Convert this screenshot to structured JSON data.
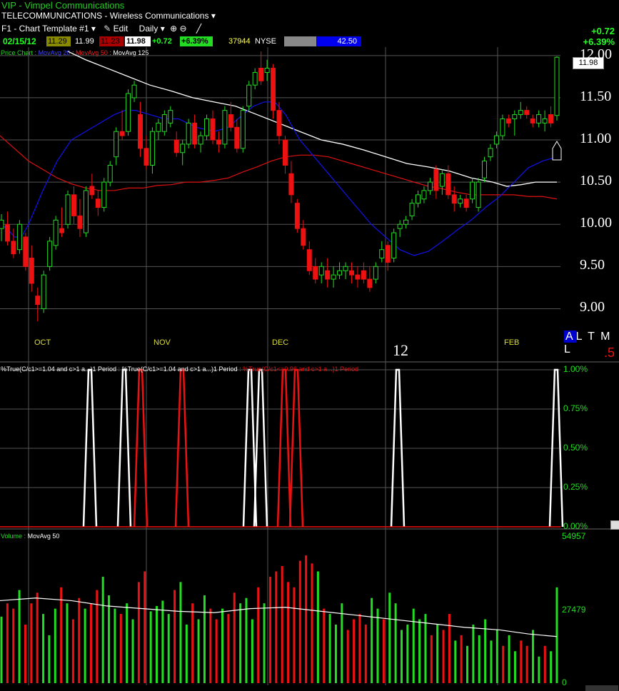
{
  "header": {
    "title": "VIP - Vimpel Communications",
    "sector": "TELECOMMUNICATIONS - Wireless Communications",
    "template": "F1 - Chart Template #1",
    "edit_label": "Edit",
    "period": "Daily"
  },
  "quote": {
    "date": "02/15/12",
    "open": "11.29",
    "high": "11.99",
    "low": "11.23",
    "close": "11.98",
    "change": "+0.72",
    "change_pct": "+6.39%",
    "volume": "37944",
    "exchange": "NYSE",
    "rank": "42.50",
    "rank_fill": 0.42
  },
  "corner": {
    "change": "+0.72",
    "change_pct": "+6.39%"
  },
  "last_price_tag": "11.98",
  "timeframes": {
    "active": "A",
    "others": "L T M L",
    "bottom_label": ".5"
  },
  "colors": {
    "up": "#22dd22",
    "down": "#ee1111",
    "ma20": "#1111ee",
    "ma50": "#dd1111",
    "ma125": "#ffffff",
    "accent": "#0000cc"
  },
  "legends": {
    "price": {
      "p0": "Price Chart",
      "p1": "MovAvg 20",
      "p2": "MovAvg 50",
      "p3": "MovAvg 125"
    },
    "ind": {
      "i1": "%True(C/c1>=1.04 and c>1 a...)1 Period",
      "i2": "%True(C/c1>=1.04 and c>1 a...)1 Period",
      "i3": "%True(C/c1<=0.96 and c>1 a...)1 Period"
    },
    "vol": {
      "v1": "Volume",
      "v2": "MovAvg 50"
    }
  },
  "chart_data": [
    {
      "type": "candlestick",
      "title": "Price Chart",
      "x_ticks": [
        "OCT",
        "NOV",
        "DEC",
        "12",
        "FEB"
      ],
      "y_ticks": [
        "12.00",
        "11.50",
        "11.00",
        "10.50",
        "10.00",
        "9.50",
        "9.00"
      ],
      "ylim": [
        8.75,
        12.1
      ],
      "grid": true,
      "candles": [
        [
          9.95,
          10.12,
          9.8,
          10.05
        ],
        [
          10.0,
          10.15,
          9.75,
          9.8
        ],
        [
          9.8,
          9.95,
          9.6,
          9.65
        ],
        [
          9.7,
          10.05,
          9.65,
          10.0
        ],
        [
          9.85,
          9.9,
          9.45,
          9.5
        ],
        [
          9.6,
          9.75,
          9.2,
          9.3
        ],
        [
          9.15,
          9.25,
          8.85,
          9.05
        ],
        [
          9.0,
          9.45,
          8.95,
          9.4
        ],
        [
          9.5,
          9.85,
          9.45,
          9.8
        ],
        [
          9.75,
          10.1,
          9.7,
          10.05
        ],
        [
          9.95,
          10.2,
          9.85,
          9.9
        ],
        [
          10.0,
          10.4,
          9.95,
          10.35
        ],
        [
          10.35,
          10.45,
          10.0,
          10.1
        ],
        [
          10.1,
          10.3,
          9.85,
          9.95
        ],
        [
          9.9,
          10.45,
          9.85,
          10.4
        ],
        [
          10.45,
          10.6,
          10.3,
          10.35
        ],
        [
          10.3,
          10.4,
          10.1,
          10.2
        ],
        [
          10.2,
          10.55,
          10.15,
          10.5
        ],
        [
          10.5,
          10.75,
          10.45,
          10.7
        ],
        [
          10.8,
          11.15,
          10.7,
          11.1
        ],
        [
          11.1,
          11.35,
          11.0,
          11.05
        ],
        [
          11.1,
          11.6,
          11.05,
          11.55
        ],
        [
          11.5,
          11.7,
          11.45,
          11.65
        ],
        [
          11.3,
          11.45,
          10.8,
          10.9
        ],
        [
          10.9,
          11.05,
          10.65,
          10.7
        ],
        [
          10.7,
          11.15,
          10.6,
          11.1
        ],
        [
          11.1,
          11.25,
          11.0,
          11.2
        ],
        [
          11.1,
          11.35,
          11.05,
          11.3
        ],
        [
          11.2,
          11.4,
          11.15,
          11.35
        ],
        [
          11.0,
          11.1,
          10.8,
          10.85
        ],
        [
          10.85,
          11.0,
          10.7,
          10.95
        ],
        [
          10.95,
          11.25,
          10.9,
          11.2
        ],
        [
          11.2,
          11.3,
          10.9,
          10.95
        ],
        [
          10.95,
          11.1,
          10.85,
          11.05
        ],
        [
          11.05,
          11.3,
          11.0,
          11.25
        ],
        [
          11.25,
          11.35,
          10.95,
          11.0
        ],
        [
          11.0,
          11.1,
          10.85,
          10.95
        ],
        [
          10.95,
          11.4,
          10.9,
          11.35
        ],
        [
          11.3,
          11.45,
          11.1,
          11.15
        ],
        [
          11.15,
          11.25,
          10.85,
          10.9
        ],
        [
          10.9,
          11.4,
          10.85,
          11.35
        ],
        [
          11.4,
          11.7,
          11.35,
          11.65
        ],
        [
          11.65,
          11.85,
          11.6,
          11.8
        ],
        [
          11.85,
          12.05,
          11.65,
          11.7
        ],
        [
          11.8,
          11.95,
          11.7,
          11.85
        ],
        [
          11.85,
          11.9,
          11.25,
          11.35
        ],
        [
          11.35,
          11.45,
          10.95,
          11.05
        ],
        [
          11.0,
          11.05,
          10.6,
          10.7
        ],
        [
          10.6,
          10.75,
          10.25,
          10.35
        ],
        [
          10.25,
          10.3,
          9.9,
          9.95
        ],
        [
          9.95,
          10.05,
          9.7,
          9.75
        ],
        [
          9.7,
          9.8,
          9.4,
          9.45
        ],
        [
          9.5,
          9.6,
          9.3,
          9.35
        ],
        [
          9.4,
          9.55,
          9.3,
          9.5
        ],
        [
          9.45,
          9.6,
          9.25,
          9.35
        ],
        [
          9.35,
          9.5,
          9.25,
          9.4
        ],
        [
          9.4,
          9.55,
          9.35,
          9.45
        ],
        [
          9.45,
          9.55,
          9.35,
          9.5
        ],
        [
          9.45,
          9.55,
          9.3,
          9.4
        ],
        [
          9.4,
          9.5,
          9.25,
          9.35
        ],
        [
          9.45,
          9.55,
          9.3,
          9.35
        ],
        [
          9.35,
          9.5,
          9.2,
          9.25
        ],
        [
          9.35,
          9.55,
          9.3,
          9.5
        ],
        [
          9.6,
          9.8,
          9.55,
          9.7
        ],
        [
          9.75,
          9.8,
          9.45,
          9.55
        ],
        [
          9.6,
          9.95,
          9.55,
          9.9
        ],
        [
          9.95,
          10.05,
          9.85,
          10.0
        ],
        [
          10.0,
          10.1,
          9.95,
          10.05
        ],
        [
          10.1,
          10.3,
          10.05,
          10.25
        ],
        [
          10.25,
          10.4,
          10.2,
          10.35
        ],
        [
          10.3,
          10.45,
          10.25,
          10.4
        ],
        [
          10.4,
          10.55,
          10.35,
          10.5
        ],
        [
          10.65,
          10.7,
          10.3,
          10.4
        ],
        [
          10.45,
          10.65,
          10.35,
          10.6
        ],
        [
          10.6,
          10.7,
          10.3,
          10.35
        ],
        [
          10.35,
          10.45,
          10.15,
          10.25
        ],
        [
          10.25,
          10.35,
          10.2,
          10.3
        ],
        [
          10.3,
          10.35,
          10.15,
          10.2
        ],
        [
          10.3,
          10.55,
          10.25,
          10.5
        ],
        [
          10.2,
          10.55,
          10.15,
          10.5
        ],
        [
          10.55,
          10.8,
          10.5,
          10.75
        ],
        [
          10.8,
          10.95,
          10.75,
          10.9
        ],
        [
          10.95,
          11.1,
          10.9,
          11.05
        ],
        [
          11.05,
          11.3,
          11.0,
          11.25
        ],
        [
          11.25,
          11.3,
          11.15,
          11.2
        ],
        [
          11.25,
          11.35,
          11.05,
          11.3
        ],
        [
          11.3,
          11.45,
          11.25,
          11.35
        ],
        [
          11.35,
          11.4,
          11.25,
          11.3
        ],
        [
          11.25,
          11.3,
          11.15,
          11.2
        ],
        [
          11.2,
          11.35,
          11.15,
          11.3
        ],
        [
          11.2,
          11.35,
          11.1,
          11.25
        ],
        [
          11.3,
          11.4,
          11.15,
          11.2
        ],
        [
          11.29,
          11.99,
          11.23,
          11.98
        ]
      ],
      "ma20_points": [
        [
          0,
          10.0
        ],
        [
          10,
          9.95
        ],
        [
          20,
          9.85
        ],
        [
          30,
          9.85
        ],
        [
          40,
          10.0
        ],
        [
          50,
          10.2
        ],
        [
          60,
          10.4
        ],
        [
          80,
          10.75
        ],
        [
          100,
          11.0
        ],
        [
          120,
          11.1
        ],
        [
          140,
          11.2
        ],
        [
          160,
          11.3
        ],
        [
          175,
          11.35
        ],
        [
          190,
          11.35
        ],
        [
          210,
          11.3
        ],
        [
          230,
          11.25
        ],
        [
          250,
          11.25
        ],
        [
          275,
          11.15
        ],
        [
          300,
          11.1
        ],
        [
          320,
          11.15
        ],
        [
          340,
          11.3
        ],
        [
          355,
          11.4
        ],
        [
          370,
          11.45
        ],
        [
          385,
          11.45
        ],
        [
          400,
          11.3
        ],
        [
          420,
          11.0
        ],
        [
          440,
          10.8
        ],
        [
          460,
          10.6
        ],
        [
          480,
          10.4
        ],
        [
          500,
          10.2
        ],
        [
          520,
          10.0
        ],
        [
          540,
          9.85
        ],
        [
          560,
          9.7
        ],
        [
          580,
          9.63
        ],
        [
          600,
          9.68
        ],
        [
          620,
          9.8
        ],
        [
          640,
          9.93
        ],
        [
          660,
          10.05
        ],
        [
          680,
          10.2
        ],
        [
          700,
          10.33
        ],
        [
          720,
          10.5
        ],
        [
          740,
          10.67
        ],
        [
          760,
          10.75
        ],
        [
          780,
          10.8
        ]
      ],
      "ma50_points": [
        [
          0,
          11.05
        ],
        [
          20,
          10.9
        ],
        [
          40,
          10.75
        ],
        [
          60,
          10.65
        ],
        [
          80,
          10.55
        ],
        [
          100,
          10.48
        ],
        [
          120,
          10.43
        ],
        [
          140,
          10.4
        ],
        [
          160,
          10.4
        ],
        [
          180,
          10.43
        ],
        [
          200,
          10.43
        ],
        [
          220,
          10.46
        ],
        [
          240,
          10.47
        ],
        [
          260,
          10.5
        ],
        [
          280,
          10.5
        ],
        [
          300,
          10.52
        ],
        [
          320,
          10.55
        ],
        [
          340,
          10.62
        ],
        [
          360,
          10.68
        ],
        [
          380,
          10.75
        ],
        [
          400,
          10.8
        ],
        [
          420,
          10.82
        ],
        [
          440,
          10.82
        ],
        [
          460,
          10.8
        ],
        [
          480,
          10.75
        ],
        [
          500,
          10.7
        ],
        [
          520,
          10.65
        ],
        [
          540,
          10.6
        ],
        [
          560,
          10.55
        ],
        [
          580,
          10.5
        ],
        [
          600,
          10.45
        ],
        [
          620,
          10.42
        ],
        [
          640,
          10.38
        ],
        [
          660,
          10.35
        ],
        [
          680,
          10.35
        ],
        [
          700,
          10.35
        ],
        [
          720,
          10.35
        ],
        [
          740,
          10.33
        ],
        [
          760,
          10.33
        ],
        [
          780,
          10.3
        ]
      ],
      "ma125_points": [
        [
          95,
          12.05
        ],
        [
          120,
          11.95
        ],
        [
          150,
          11.85
        ],
        [
          180,
          11.75
        ],
        [
          210,
          11.65
        ],
        [
          240,
          11.58
        ],
        [
          270,
          11.5
        ],
        [
          300,
          11.45
        ],
        [
          330,
          11.4
        ],
        [
          360,
          11.3
        ],
        [
          390,
          11.2
        ],
        [
          420,
          11.1
        ],
        [
          450,
          11.0
        ],
        [
          480,
          10.95
        ],
        [
          510,
          10.88
        ],
        [
          540,
          10.8
        ],
        [
          570,
          10.72
        ],
        [
          600,
          10.68
        ],
        [
          630,
          10.63
        ],
        [
          660,
          10.55
        ],
        [
          690,
          10.5
        ],
        [
          710,
          10.45
        ],
        [
          730,
          10.47
        ],
        [
          750,
          10.5
        ],
        [
          780,
          10.5
        ]
      ]
    },
    {
      "type": "line",
      "title": "%True indicator",
      "y_ticks": [
        "1.00%",
        "0.75%",
        "0.50%",
        "0.25%",
        "0.00%"
      ],
      "ylim": [
        0,
        1
      ],
      "series": [
        {
          "name": "%True(C/c1>=1.04 and c>1 a...)1 Period",
          "color": "#ffffff",
          "spike_x": [
            126,
            174,
            350,
            365,
            557,
            779
          ],
          "value": 1.0
        },
        {
          "name": "%True(C/c1<=0.96 and c>1 a...)1 Period",
          "color": "#ee1111",
          "spike_x": [
            197,
            255,
            398,
            415
          ],
          "value": 1.0
        }
      ]
    },
    {
      "type": "bar",
      "title": "Volume",
      "y_ticks": [
        "54957",
        "27479",
        "0"
      ],
      "ylim": [
        0,
        54957
      ],
      "volumes": [
        25,
        30,
        28,
        35,
        22,
        30,
        34,
        26,
        18,
        28,
        36,
        30,
        24,
        32,
        28,
        30,
        35,
        40,
        33,
        28,
        26,
        30,
        24,
        38,
        42,
        27,
        29,
        31,
        26,
        35,
        38,
        22,
        30,
        24,
        33,
        28,
        24,
        28,
        26,
        34,
        30,
        32,
        24,
        36,
        30,
        40,
        42,
        44,
        38,
        36,
        46,
        48,
        45,
        42,
        28,
        26,
        22,
        30,
        20,
        24,
        26,
        22,
        32,
        28,
        24,
        34,
        30,
        20,
        22,
        28,
        24,
        26,
        18,
        22,
        20,
        26,
        16,
        18,
        14,
        22,
        18,
        24,
        16,
        20,
        14,
        18,
        12,
        16,
        14,
        20,
        10,
        14,
        12,
        36
      ],
      "ma_points": [
        [
          0,
          31
        ],
        [
          50,
          32
        ],
        [
          100,
          31
        ],
        [
          150,
          29
        ],
        [
          200,
          28
        ],
        [
          250,
          27
        ],
        [
          300,
          26.5
        ],
        [
          350,
          28
        ],
        [
          400,
          28.5
        ],
        [
          450,
          27
        ],
        [
          500,
          25.5
        ],
        [
          550,
          24
        ],
        [
          600,
          22.5
        ],
        [
          650,
          21
        ],
        [
          700,
          20
        ],
        [
          740,
          18.5
        ],
        [
          780,
          17.5
        ]
      ]
    }
  ]
}
